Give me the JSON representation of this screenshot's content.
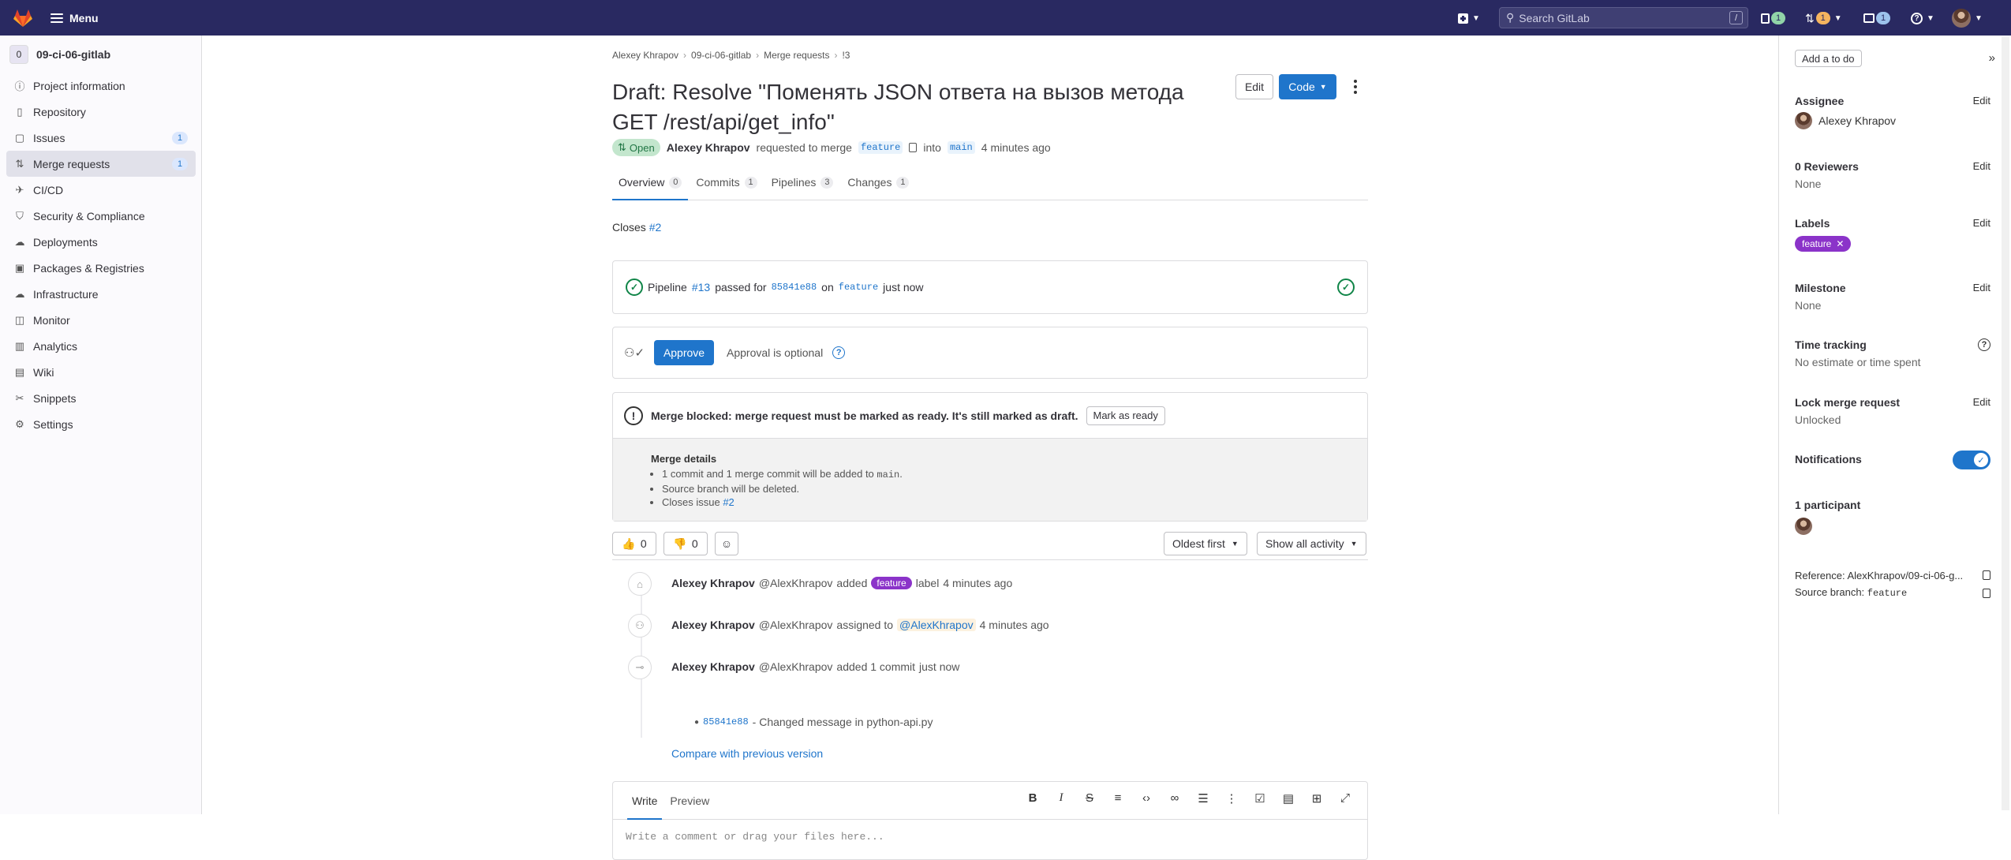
{
  "topbar": {
    "menu_label": "Menu",
    "search_placeholder": "Search GitLab",
    "search_shortcut": "/",
    "issues_count": "1",
    "mr_count": "1",
    "todo_count": "1"
  },
  "sidebar": {
    "project_initial": "0",
    "project_name": "09-ci-06-gitlab",
    "items": [
      {
        "label": "Project information",
        "icon": "info-icon"
      },
      {
        "label": "Repository",
        "icon": "doc-icon"
      },
      {
        "label": "Issues",
        "icon": "issues-icon",
        "count": "1"
      },
      {
        "label": "Merge requests",
        "icon": "merge-request-icon",
        "count": "1"
      },
      {
        "label": "CI/CD",
        "icon": "rocket-icon"
      },
      {
        "label": "Security & Compliance",
        "icon": "shield-icon"
      },
      {
        "label": "Deployments",
        "icon": "deploy-icon"
      },
      {
        "label": "Packages & Registries",
        "icon": "package-icon"
      },
      {
        "label": "Infrastructure",
        "icon": "cloud-icon"
      },
      {
        "label": "Monitor",
        "icon": "monitor-icon"
      },
      {
        "label": "Analytics",
        "icon": "chart-icon"
      },
      {
        "label": "Wiki",
        "icon": "book-icon"
      },
      {
        "label": "Snippets",
        "icon": "snippet-icon"
      },
      {
        "label": "Settings",
        "icon": "gear-icon"
      }
    ]
  },
  "breadcrumb": [
    "Alexey Khrapov",
    "09-ci-06-gitlab",
    "Merge requests",
    "!3"
  ],
  "mr": {
    "title": "Draft: Resolve \"Поменять JSON ответа на вызов метода GET /rest/api/get_info\"",
    "edit_label": "Edit",
    "code_label": "Code",
    "status": "Open",
    "author": "Alexey Khrapov",
    "requested_text": "requested to merge",
    "source_branch": "feature",
    "into_text": "into",
    "target_branch": "main",
    "time": "4 minutes ago"
  },
  "tabs": [
    {
      "label": "Overview",
      "count": "0"
    },
    {
      "label": "Commits",
      "count": "1"
    },
    {
      "label": "Pipelines",
      "count": "3"
    },
    {
      "label": "Changes",
      "count": "1"
    }
  ],
  "closes": {
    "text": "Closes",
    "issue": "#2"
  },
  "pipeline": {
    "prefix": "Pipeline",
    "id": "#13",
    "passed_text": "passed for",
    "sha": "85841e88",
    "on_text": "on",
    "branch": "feature",
    "time": "just now"
  },
  "approval": {
    "button": "Approve",
    "note": "Approval is optional"
  },
  "merge": {
    "blocked_text": "Merge blocked: merge request must be marked as ready. It's still marked as draft.",
    "ready_button": "Mark as ready",
    "details_title": "Merge details",
    "detail_1_prefix": "1 commit and 1 merge commit will be added to",
    "detail_1_branch": "main",
    "detail_2": "Source branch will be deleted.",
    "detail_3_prefix": "Closes issue",
    "detail_3_issue": "#2"
  },
  "reactions": {
    "thumbs_up": "0",
    "thumbs_down": "0",
    "sort": "Oldest first",
    "filter": "Show all activity"
  },
  "activity": [
    {
      "author": "Alexey Khrapov",
      "handle": "@AlexKhrapov",
      "action": "added",
      "label": "feature",
      "suffix": "label",
      "time": "4 minutes ago"
    },
    {
      "author": "Alexey Khrapov",
      "handle": "@AlexKhrapov",
      "action": "assigned to",
      "mention": "@AlexKhrapov",
      "time": "4 minutes ago"
    },
    {
      "author": "Alexey Khrapov",
      "handle": "@AlexKhrapov",
      "action": "added 1 commit",
      "time": "just now"
    }
  ],
  "commit": {
    "sha": "85841e88",
    "message": "- Changed message in python-api.py"
  },
  "compare_link": "Compare with previous version",
  "editor": {
    "write": "Write",
    "preview": "Preview",
    "placeholder": "Write a comment or drag your files here..."
  },
  "right": {
    "todo": "Add a to do",
    "edit": "Edit",
    "assignee_title": "Assignee",
    "assignee_name": "Alexey Khrapov",
    "reviewers_title": "0 Reviewers",
    "reviewers_value": "None",
    "labels_title": "Labels",
    "label": "feature",
    "milestone_title": "Milestone",
    "milestone_value": "None",
    "time_title": "Time tracking",
    "time_value": "No estimate or time spent",
    "lock_title": "Lock merge request",
    "lock_value": "Unlocked",
    "notifications_title": "Notifications",
    "participants_title": "1 participant",
    "reference": "Reference: AlexKhrapov/09-ci-06-g...",
    "source_branch_label": "Source branch:",
    "source_branch_value": "feature"
  },
  "colors": {
    "brand": "#292961",
    "accent": "#1f75cb",
    "label": "#8b33c9",
    "success": "#108548"
  }
}
